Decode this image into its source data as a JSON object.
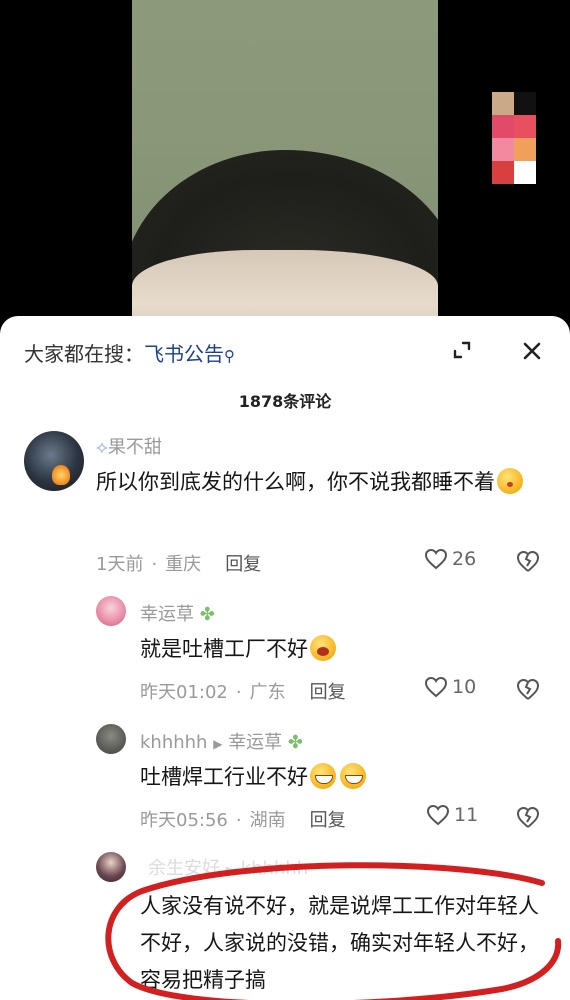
{
  "search_bar": {
    "prefix": "大家都在搜：",
    "keyword": "飞书公告"
  },
  "comment_count": "1878条评论",
  "comments": [
    {
      "user": "果不甜",
      "text": "所以你到底发的什么啊，你不说我都睡不着",
      "time": "1天前",
      "location": "重庆",
      "reply_label": "回复",
      "likes": "26"
    },
    {
      "user": "幸运草",
      "text": "就是吐槽工厂不好",
      "time": "昨天01:02",
      "location": "广东",
      "reply_label": "回复",
      "likes": "10"
    },
    {
      "user": "khhhhh",
      "reply_to": "幸运草",
      "text": "吐槽焊工行业不好",
      "time": "昨天05:56",
      "location": "湖南",
      "reply_label": "回复",
      "likes": "11"
    },
    {
      "user": "余生安好",
      "reply_to": "khhhhh",
      "text": "人家没有说不好，就是说焊工工作对年轻人不好，人家说的没错，确实对年轻人不好，容易把精子搞"
    }
  ],
  "colors": {
    "keyword": "#1f3f8f",
    "annotation_circle": "#d21f1f",
    "sheet_bg": "#ffffff"
  }
}
